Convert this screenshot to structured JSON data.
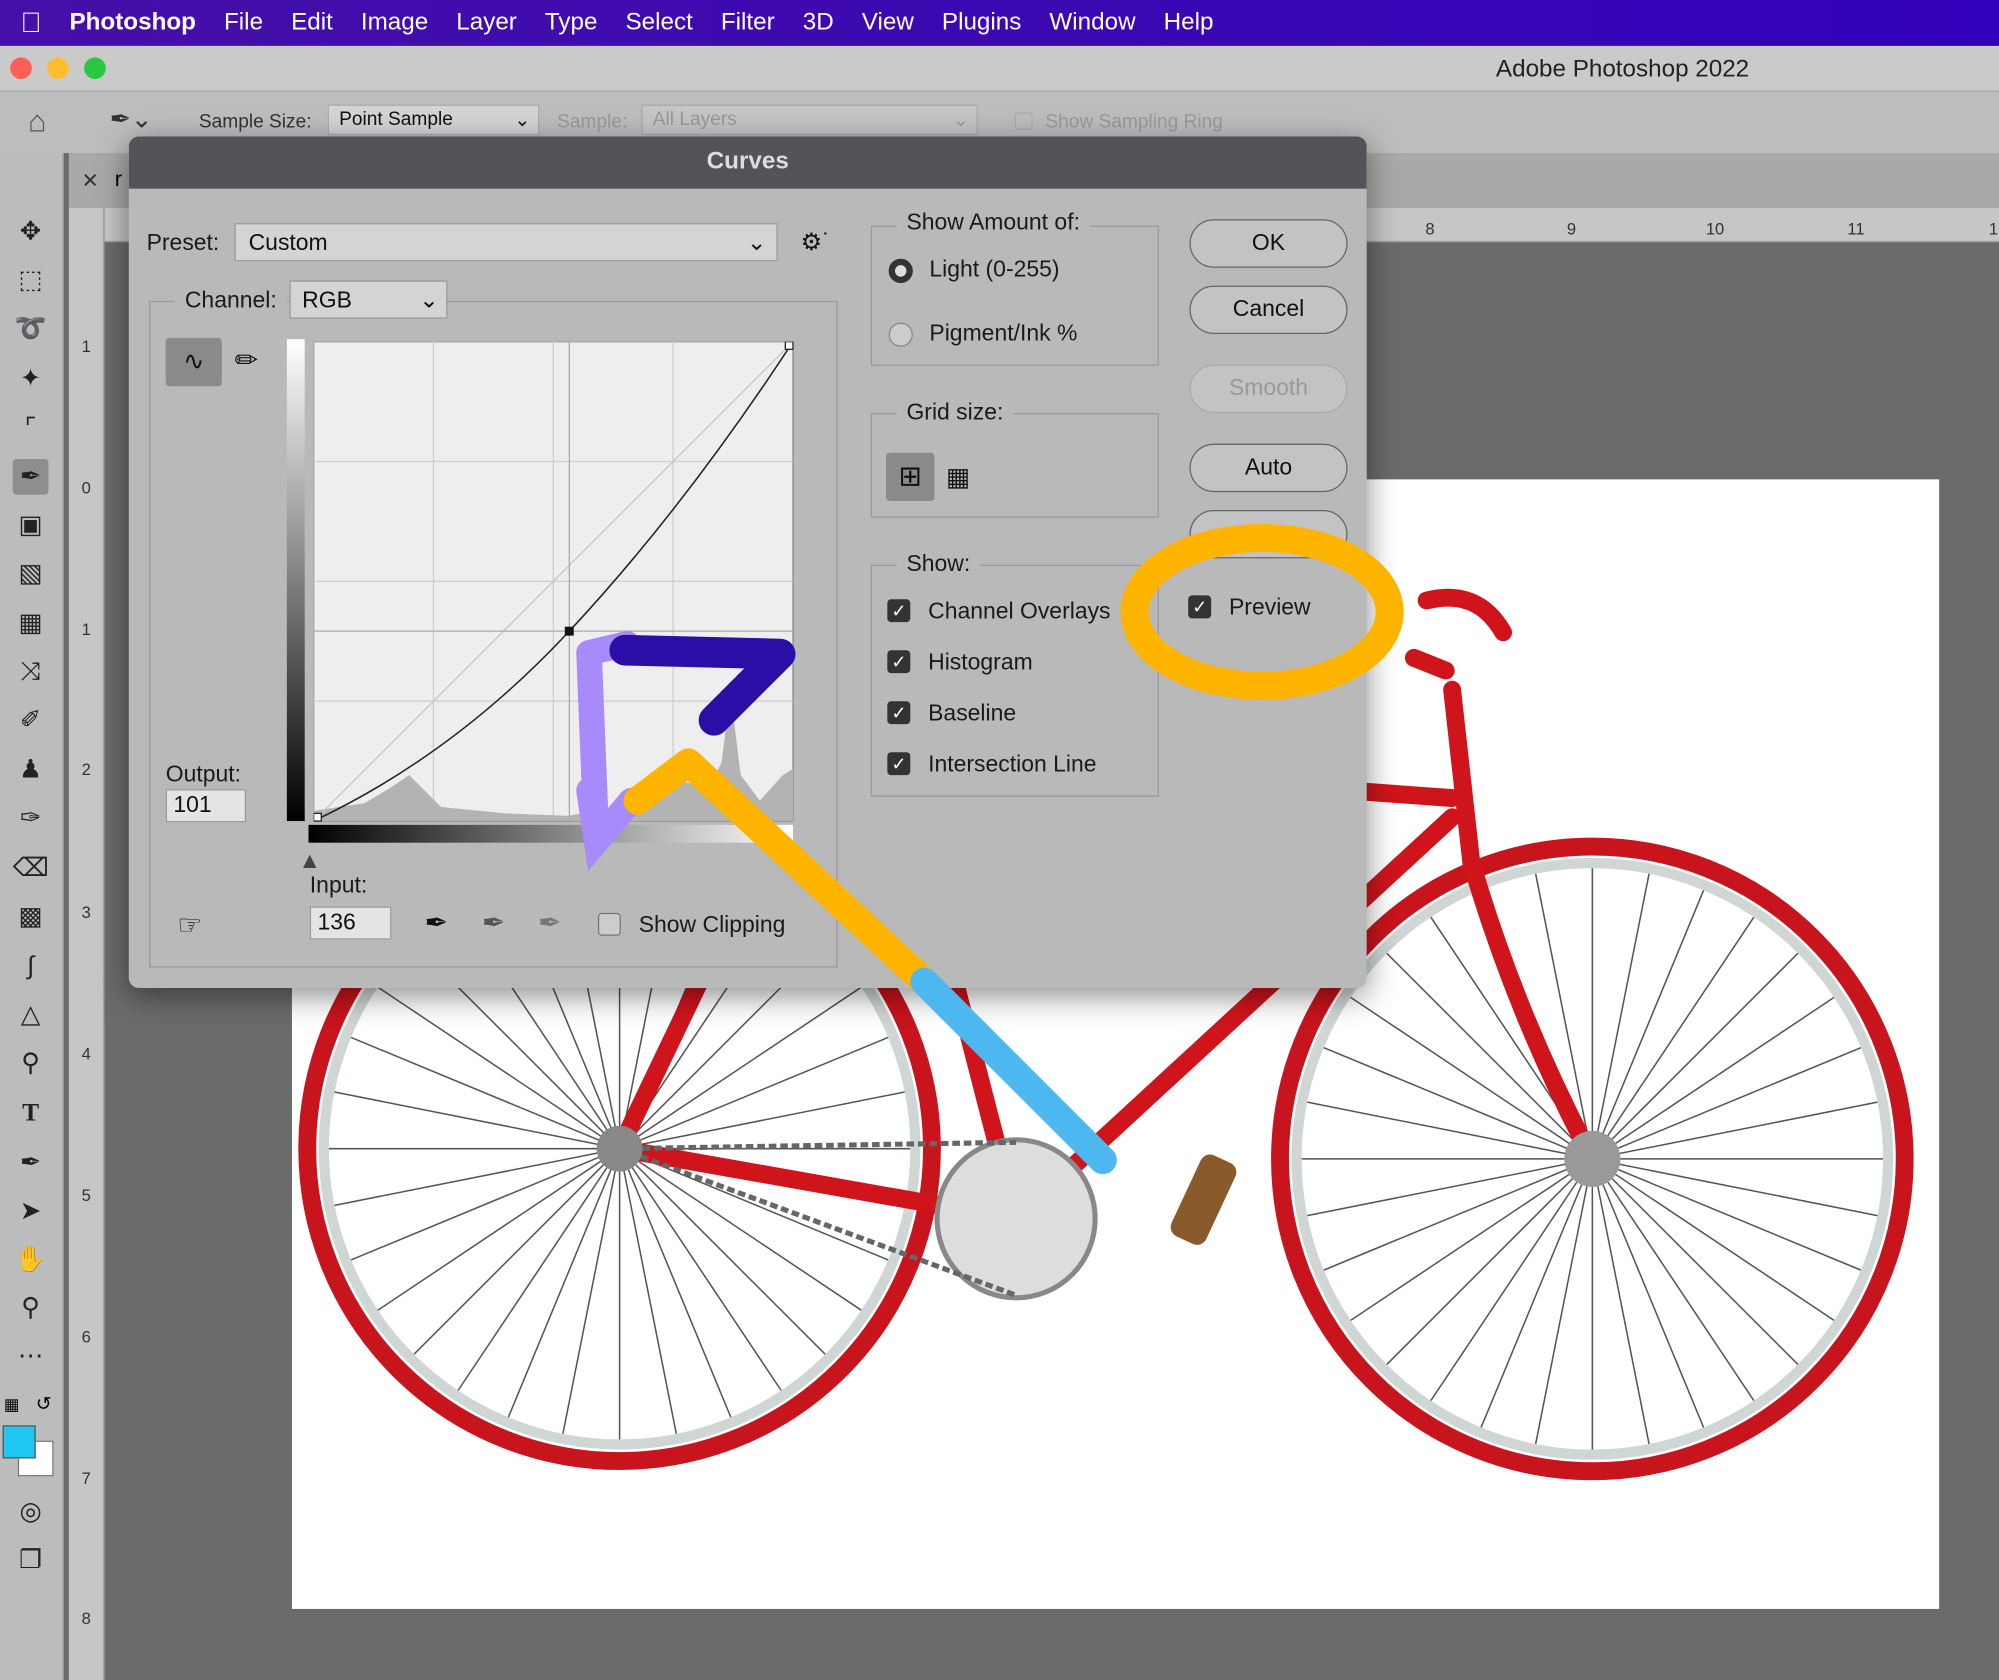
{
  "menubar": {
    "app": "Photoshop",
    "items": [
      "File",
      "Edit",
      "Image",
      "Layer",
      "Type",
      "Select",
      "Filter",
      "3D",
      "View",
      "Plugins",
      "Window",
      "Help"
    ]
  },
  "window": {
    "title": "Adobe Photoshop 2022"
  },
  "options": {
    "sample_size_label": "Sample Size:",
    "sample_size_value": "Point Sample",
    "sample_label": "Sample:",
    "sample_value": "All Layers",
    "sampling_ring": "Show Sampling Ring"
  },
  "tab": {
    "name": "r"
  },
  "rulers": {
    "top": [
      "8",
      "9",
      "10",
      "11",
      "1"
    ],
    "left": [
      "1",
      "0",
      "1",
      "2",
      "3",
      "4",
      "5",
      "6",
      "7",
      "8"
    ]
  },
  "colors": {
    "foreground": "#1ec8f0",
    "background": "#ffffff",
    "menubar": "#3a0cb0"
  },
  "curves": {
    "title": "Curves",
    "preset_label": "Preset:",
    "preset_value": "Custom",
    "channel_label": "Channel:",
    "channel_value": "RGB",
    "output_label": "Output:",
    "output_value": "101",
    "input_label": "Input:",
    "input_value": "136",
    "show_clipping": "Show Clipping",
    "show_amount_label": "Show Amount of:",
    "light": "Light  (0-255)",
    "pigment": "Pigment/Ink %",
    "grid_size_label": "Grid size:",
    "show_label": "Show:",
    "show_items": [
      {
        "label": "Channel Overlays",
        "checked": true
      },
      {
        "label": "Histogram",
        "checked": true
      },
      {
        "label": "Baseline",
        "checked": true
      },
      {
        "label": "Intersection Line",
        "checked": true
      }
    ],
    "buttons": {
      "ok": "OK",
      "cancel": "Cancel",
      "smooth": "Smooth",
      "auto": "Auto"
    },
    "preview": "Preview",
    "preview_checked": true,
    "point": {
      "input": 136,
      "output": 101
    }
  }
}
